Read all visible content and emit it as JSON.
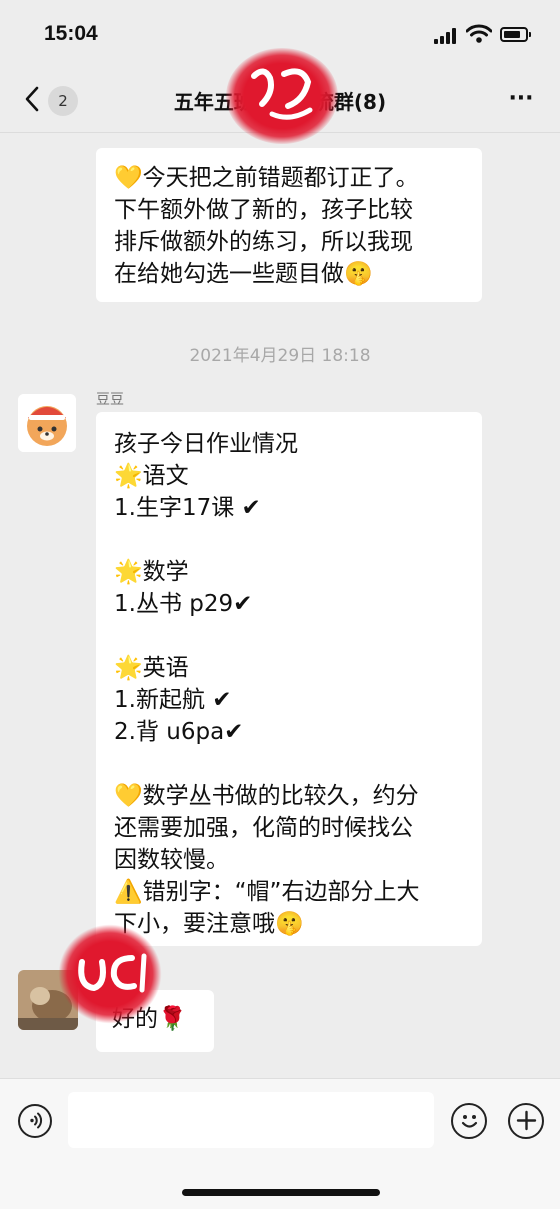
{
  "status_bar": {
    "time": "15:04"
  },
  "header": {
    "back_count": "2",
    "title": "五年五班家长交流群(8)",
    "more": "···"
  },
  "messages": [
    {
      "type": "text",
      "text": "💛今天把之前错题都订正了。\n下午额外做了新的，孩子比较\n排斥做额外的练习，所以我现\n在给她勾选一些题目做🤫"
    },
    {
      "type": "timestamp",
      "text": "2021年4月29日 18:18"
    },
    {
      "type": "text",
      "sender": "豆豆",
      "lines": [
        "孩子今日作业情况",
        "🌟语文",
        "1.生字17课 ✔",
        "",
        "🌟数学",
        "1.丛书 p29✔",
        "",
        "🌟英语",
        "1.新起航 ✔",
        "2.背 u6pa✔",
        "",
        "💛数学丛书做的比较久，约分",
        "还需要加强，化简的时候找公",
        "因数较慢。",
        "⚠️错别字：“帽”右边部分上大",
        "下小，要注意哦🤫"
      ]
    },
    {
      "type": "text",
      "text": "好的🌹"
    }
  ],
  "colors": {
    "background": "#ededed",
    "bubble": "#ffffff",
    "watermark": "#e0182e"
  },
  "icons": [
    "back-icon",
    "more-icon",
    "voice-icon",
    "emoji-icon",
    "plus-icon"
  ]
}
